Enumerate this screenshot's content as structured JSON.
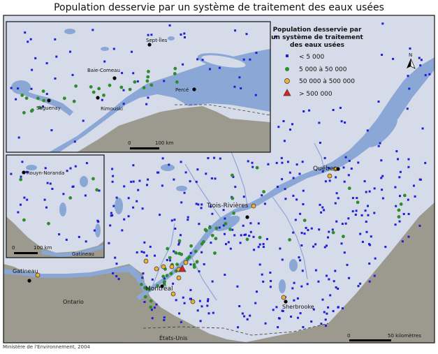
{
  "title": "Population desservie par un système de traitement des eaux usées",
  "credit": "Ministère de l'Environnement, 2004",
  "legend": {
    "title": [
      "Population desservie par",
      "un système de traitement",
      "des eaux usées"
    ],
    "items": [
      {
        "label": "< 5 000",
        "symbol": "square",
        "color": "#1f1fd6"
      },
      {
        "label": "5 000 à 50 000",
        "symbol": "circle",
        "color": "#2e8b2e"
      },
      {
        "label": "50 000 à 500 000",
        "symbol": "circle",
        "color": "#f0b030"
      },
      {
        "label": "> 500 000",
        "symbol": "triangle",
        "color": "#e02020"
      }
    ]
  },
  "north_label": "N",
  "scale_main": {
    "start": "0",
    "end": "50 kilomètres"
  },
  "scale_inset_north": {
    "start": "0",
    "end": "100 km"
  },
  "scale_inset_west": {
    "start": "0",
    "end": "100 km"
  },
  "places": {
    "quebec": "Québec",
    "trois_rivieres": "Trois-Rivières",
    "montreal": "Montréal",
    "sherbrooke": "Sherbrooke",
    "gatineau_main": "Gatineau",
    "gatineau_inset": "Gatineau",
    "ontario": "Ontario",
    "etats_unis": "États-Unis",
    "sept_iles": "Sept-Îles",
    "baie_comeau": "Baie-Comeau",
    "rimouski": "Rimouski",
    "perce": "Percé",
    "saguenay": "Saguenay",
    "rouyn": "Rouyn-Noranda"
  },
  "colors": {
    "land": "#d6dbe9",
    "water": "#8aa7d6",
    "outside": "#9c9a8e",
    "border": "#111111"
  }
}
